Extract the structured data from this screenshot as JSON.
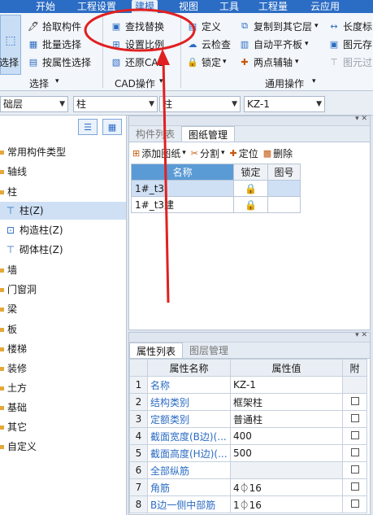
{
  "menu": [
    "开始",
    "工程设置",
    "建模",
    "视图",
    "工具",
    "工程量",
    "云应用"
  ],
  "ribbon": {
    "select_big": "选择",
    "select_items": [
      "拾取构件",
      "批量选择",
      "按属性选择"
    ],
    "select_group": "选择",
    "cad_items": [
      "查找替换",
      "设置比例",
      "还原CAD"
    ],
    "cad_group": "CAD操作",
    "common_items": [
      "定义",
      "云检查",
      "锁定",
      "复制到其它层",
      "自动平齐板",
      "两点辅轴",
      "长度标",
      "图元存",
      "图元过"
    ],
    "common_group": "通用操作"
  },
  "selectors": [
    "础层",
    "柱",
    "柱",
    "KZ-1"
  ],
  "tree": {
    "items": [
      "常用构件类型",
      "轴线",
      "柱",
      "柱(Z)",
      "构造柱(Z)",
      "砌体柱(Z)",
      "墙",
      "门窗洞",
      "梁",
      "板",
      "楼梯",
      "装修",
      "土方",
      "基础",
      "其它",
      "自定义"
    ]
  },
  "drawing_panel": {
    "tabs": [
      "构件列表",
      "图纸管理"
    ],
    "toolbar": [
      "添加图纸",
      "分割",
      "定位",
      "删除"
    ],
    "columns": [
      "名称",
      "锁定",
      "图号"
    ],
    "rows": [
      "1#_t3",
      "1#_t3建"
    ]
  },
  "property_panel": {
    "tabs": [
      "属性列表",
      "图层管理"
    ],
    "columns": [
      "属性名称",
      "属性值",
      "附"
    ],
    "rows": [
      {
        "n": "1",
        "name": "名称",
        "value": "KZ-1"
      },
      {
        "n": "2",
        "name": "结构类别",
        "value": "框架柱"
      },
      {
        "n": "3",
        "name": "定额类别",
        "value": "普通柱"
      },
      {
        "n": "4",
        "name": "截面宽度(B边)(...",
        "value": "400"
      },
      {
        "n": "5",
        "name": "截面高度(H边)(...",
        "value": "500"
      },
      {
        "n": "6",
        "name": "全部纵筋",
        "value": ""
      },
      {
        "n": "7",
        "name": "角筋",
        "value": "4⏀16"
      },
      {
        "n": "8",
        "name": "B边一侧中部筋",
        "value": "1⏀16"
      }
    ]
  },
  "colors": {
    "accent": "#2b6cc4",
    "annotation": "#e02020"
  }
}
